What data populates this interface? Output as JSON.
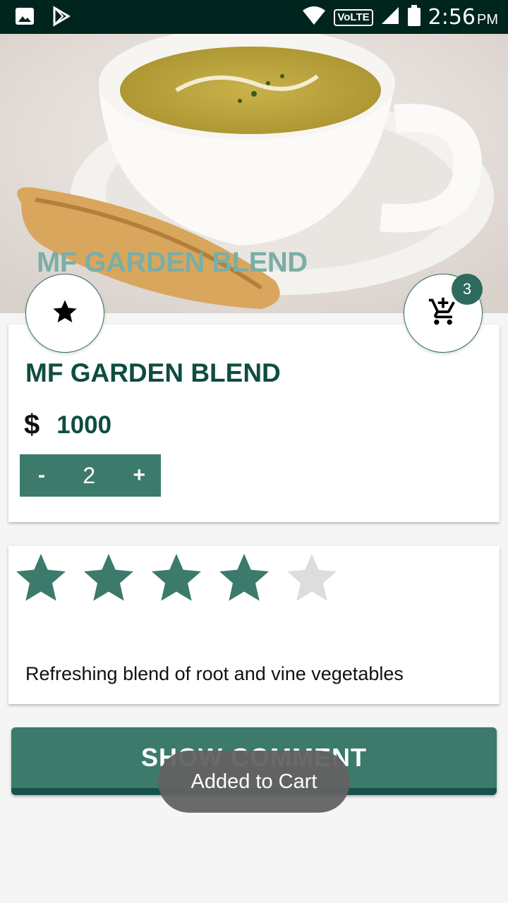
{
  "status_bar": {
    "time": "2:56",
    "ampm": "PM",
    "network_label": "VoLTE",
    "icons": [
      "image-icon",
      "play-store-icon",
      "wifi-icon",
      "signal-icon",
      "battery-icon"
    ]
  },
  "product": {
    "hero_title": "MF GARDEN BLEND",
    "name": "MF GARDEN BLEND",
    "currency": "$",
    "price": "1000",
    "quantity": "2",
    "decrement_label": "-",
    "increment_label": "+",
    "rating": 4,
    "max_rating": 5,
    "description": "Refreshing blend of root and vine vegetables"
  },
  "cart": {
    "badge_count": "3"
  },
  "actions": {
    "show_comment_label": "SHOW COMMENT"
  },
  "toast": {
    "message": "Added to Cart"
  },
  "colors": {
    "primary": "#3c7a6c",
    "primary_dark": "#0f4d41",
    "star_filled": "#3c7a6c",
    "star_empty": "#dddddd",
    "status_bar": "#00241e"
  }
}
